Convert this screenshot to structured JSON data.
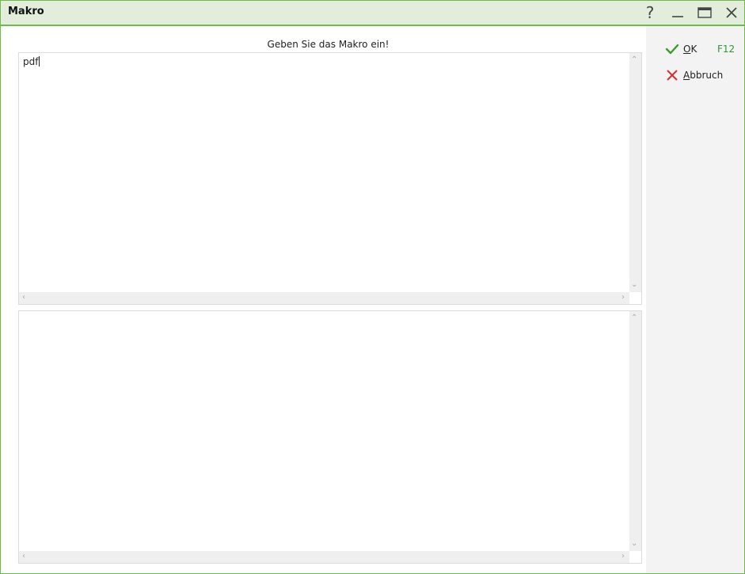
{
  "window": {
    "title": "Makro",
    "controls": {
      "help": "?"
    }
  },
  "main": {
    "prompt": "Geben Sie das Makro ein!",
    "editor_top": {
      "value": "pdf"
    },
    "editor_bottom": {
      "value": ""
    }
  },
  "sidebar": {
    "ok": {
      "mnemonic": "O",
      "rest": "K",
      "shortcut": "F12"
    },
    "cancel": {
      "mnemonic": "A",
      "rest": "bbruch"
    }
  },
  "colors": {
    "titlebar_bg": "#e2eedb",
    "border_accent": "#6fb84a",
    "ok_icon": "#3c9c2e",
    "cancel_icon": "#d83030",
    "shortcut_text": "#2e9a2e",
    "side_bg": "#f3f3f3"
  },
  "icons": {
    "help": "help-icon",
    "minimize": "minimize-icon",
    "maximize": "maximize-icon",
    "close": "close-icon",
    "ok": "checkmark-icon",
    "cancel": "cross-icon"
  }
}
